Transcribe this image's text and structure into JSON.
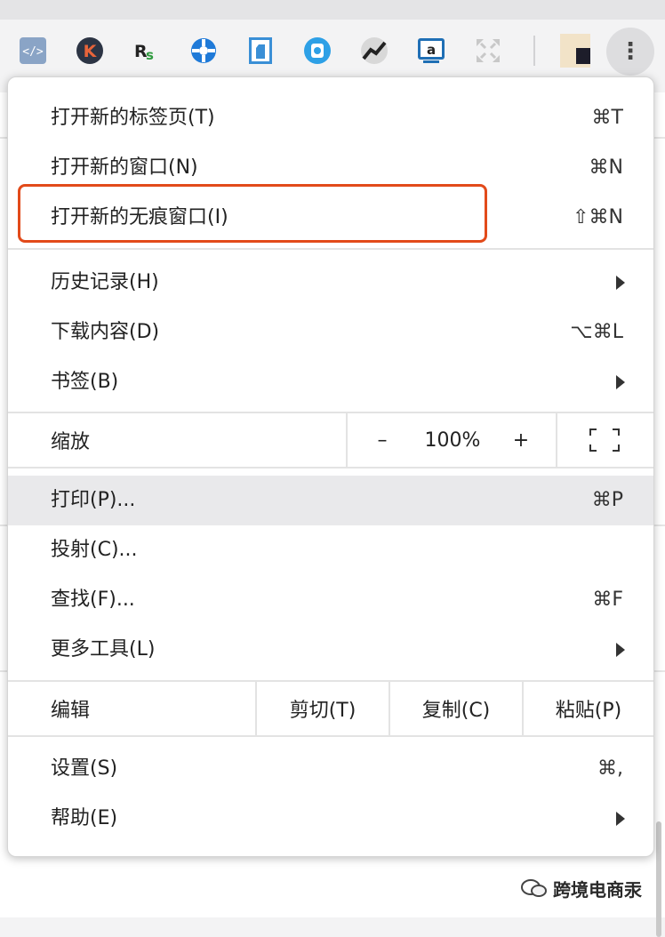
{
  "toolbar": {
    "extensions": [
      {
        "name": "code-extension-icon",
        "bg": "#8aa4c6",
        "glyph": "</>"
      },
      {
        "name": "k-extension-icon",
        "bg": "#2c3444",
        "glyph": "K"
      },
      {
        "name": "rs-extension-icon",
        "bg": "#ffffff",
        "glyph": "Rs"
      },
      {
        "name": "blue-circle-extension-icon",
        "bg": "#1f7ad8",
        "glyph": "✚"
      },
      {
        "name": "fist-extension-icon",
        "bg": "#3a8fd6",
        "glyph": "✊"
      },
      {
        "name": "q-extension-icon",
        "bg": "#2da0e6",
        "glyph": "◉"
      },
      {
        "name": "chart-extension-icon",
        "bg": "#3a3a3a",
        "glyph": "↗"
      },
      {
        "name": "amazon-extension-icon",
        "bg": "#1f6fb5",
        "glyph": "a"
      },
      {
        "name": "expand-extension-icon",
        "bg": "#dcdcdc",
        "glyph": "⤢"
      }
    ],
    "menu_glyph": "⋮"
  },
  "menu": {
    "group1": [
      {
        "label": "打开新的标签页(T)",
        "shortcut": "⌘T"
      },
      {
        "label": "打开新的窗口(N)",
        "shortcut": "⌘N"
      },
      {
        "label": "打开新的无痕窗口(I)",
        "shortcut": "⇧⌘N"
      }
    ],
    "group2": [
      {
        "label": "历史记录(H)",
        "shortcut": ""
      },
      {
        "label": "下载内容(D)",
        "shortcut": "⌥⌘L"
      },
      {
        "label": "书签(B)",
        "shortcut": ""
      }
    ],
    "zoom": {
      "label": "缩放",
      "minus": "–",
      "value": "100%",
      "plus": "+"
    },
    "group3": [
      {
        "label": "打印(P)...",
        "shortcut": "⌘P"
      },
      {
        "label": "投射(C)...",
        "shortcut": ""
      },
      {
        "label": "查找(F)...",
        "shortcut": "⌘F"
      },
      {
        "label": "更多工具(L)",
        "shortcut": ""
      }
    ],
    "edit": {
      "label": "编辑",
      "cut": "剪切(T)",
      "copy": "复制(C)",
      "paste": "粘贴(P)"
    },
    "group4": [
      {
        "label": "设置(S)",
        "shortcut": "⌘,"
      },
      {
        "label": "帮助(E)",
        "shortcut": ""
      }
    ]
  },
  "watermark": {
    "text": "跨境电商汞"
  },
  "colors": {
    "highlight_border": "#e24a1a",
    "hover_row": "#e9e9eb"
  }
}
